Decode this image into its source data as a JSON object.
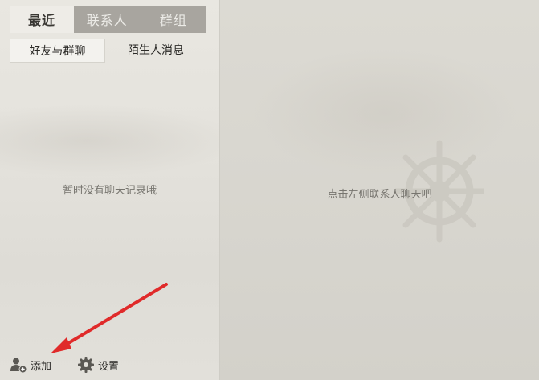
{
  "main_tabs": [
    {
      "label": "最近"
    },
    {
      "label": "联系人"
    },
    {
      "label": "群组"
    }
  ],
  "sub_tabs": [
    {
      "label": "好友与群聊"
    },
    {
      "label": "陌生人消息"
    }
  ],
  "left_empty_text": "暂时没有聊天记录哦",
  "right_empty_text": "点击左侧联系人聊天吧",
  "bottom": {
    "add_label": "添加",
    "settings_label": "设置"
  },
  "colors": {
    "arrow": "#e02a2a",
    "tab_bar": "#a8a59f",
    "active_tab": "#eeece7"
  },
  "icons": [
    "add-contact-icon",
    "gear-icon",
    "ship-wheel-icon"
  ]
}
